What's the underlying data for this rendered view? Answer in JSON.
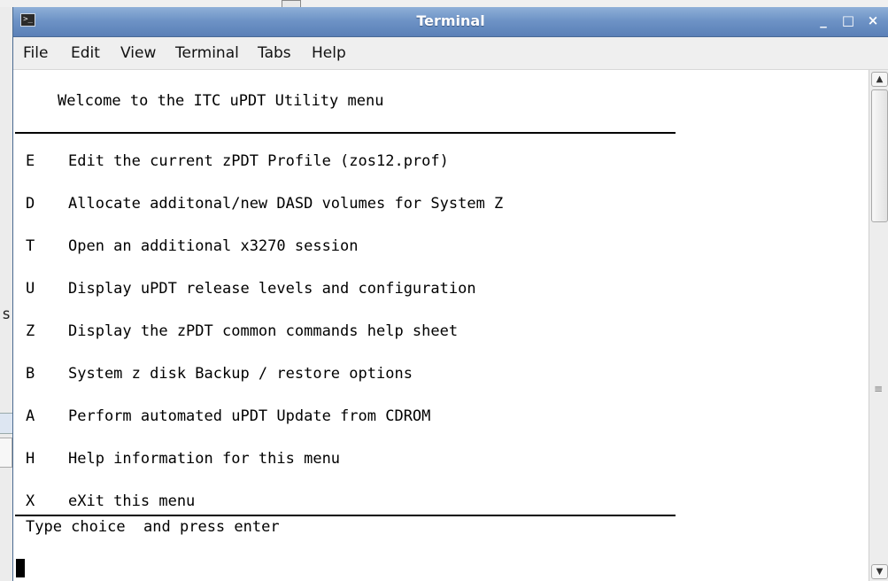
{
  "window": {
    "title": "Terminal",
    "controls": {
      "minimize": "_",
      "maximize": "□",
      "close": "×"
    },
    "icon": "terminal-icon"
  },
  "desktop": {
    "partial_text": "s"
  },
  "menubar": {
    "items": [
      "File",
      "Edit",
      "View",
      "Terminal",
      "Tabs",
      "Help"
    ]
  },
  "terminal": {
    "welcome": "Welcome to the ITC uPDT Utility menu",
    "options": [
      {
        "key": "E",
        "text": "Edit the current zPDT Profile (zos12.prof)"
      },
      {
        "key": "D",
        "text": "Allocate additonal/new DASD volumes for System Z"
      },
      {
        "key": "T",
        "text": "Open an additional x3270 session"
      },
      {
        "key": "U",
        "text": "Display uPDT release levels and configuration"
      },
      {
        "key": "Z",
        "text": "Display the zPDT common commands help sheet"
      },
      {
        "key": "B",
        "text": "System z disk Backup / restore options"
      },
      {
        "key": "A",
        "text": "Perform automated uPDT Update from CDROM"
      },
      {
        "key": "H",
        "text": "Help information for this menu"
      },
      {
        "key": "X",
        "text": "eXit this menu"
      }
    ],
    "prompt": "Type choice  and press enter"
  },
  "scrollbar": {
    "up_icon": "▲",
    "down_icon": "▼",
    "grip": "≡"
  }
}
